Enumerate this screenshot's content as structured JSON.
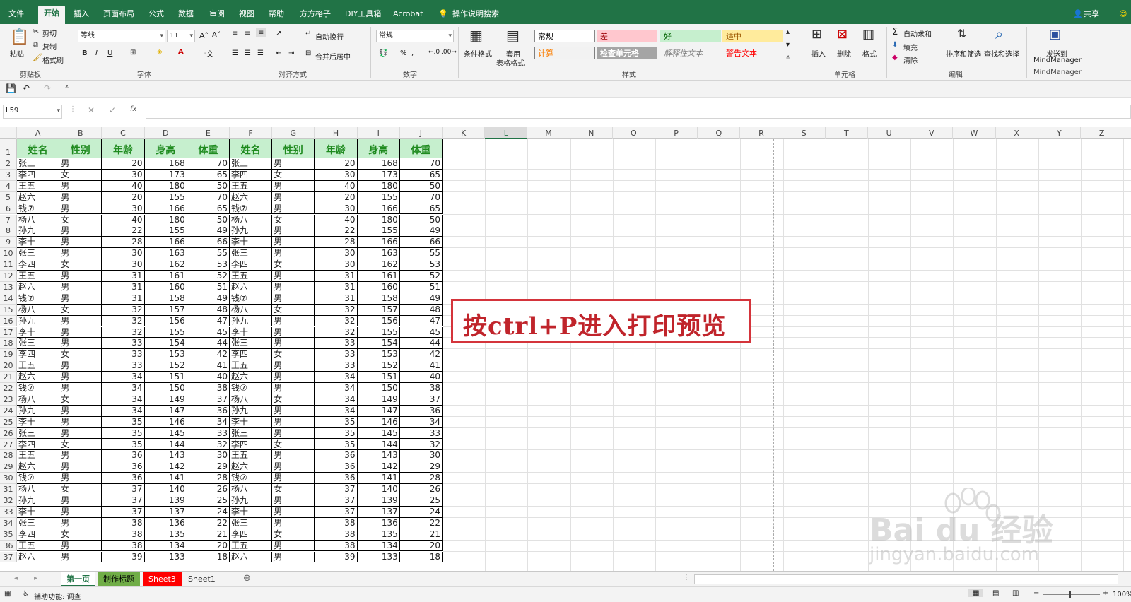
{
  "menu": {
    "tabs": [
      "文件",
      "开始",
      "插入",
      "页面布局",
      "公式",
      "数据",
      "审阅",
      "视图",
      "帮助",
      "方方格子",
      "DIY工具箱",
      "Acrobat"
    ],
    "active": "开始",
    "tell_me": "操作说明搜索",
    "share": "共享"
  },
  "ribbon": {
    "clipboard": {
      "paste": "粘贴",
      "cut": "剪切",
      "copy": "复制",
      "format_painter": "格式刷",
      "label": "剪贴板"
    },
    "font": {
      "name": "等线",
      "size": "11",
      "bold": "B",
      "italic": "I",
      "underline": "U",
      "label": "字体"
    },
    "align": {
      "wrap": "自动换行",
      "merge": "合并后居中",
      "label": "对齐方式"
    },
    "number": {
      "format": "常规",
      "label": "数字"
    },
    "styles": {
      "cond": "条件格式",
      "table1": "套用",
      "table2": "表格格式",
      "label": "样式",
      "cells": [
        {
          "t": "常规",
          "bg": "#ffffff",
          "fg": "#000000"
        },
        {
          "t": "差",
          "bg": "#ffc7ce",
          "fg": "#9c0006"
        },
        {
          "t": "好",
          "bg": "#c6efce",
          "fg": "#006100"
        },
        {
          "t": "适中",
          "bg": "#ffeb9c",
          "fg": "#9c5700"
        },
        {
          "t": "计算",
          "bg": "#f2f2f2",
          "fg": "#fa7d00"
        },
        {
          "t": "检查单元格",
          "bg": "#a5a5a5",
          "fg": "#ffffff"
        },
        {
          "t": "解释性文本",
          "bg": "#f3f3f3",
          "fg": "#7f7f7f"
        },
        {
          "t": "警告文本",
          "bg": "#f3f3f3",
          "fg": "#ff0000"
        }
      ]
    },
    "cells": {
      "insert": "插入",
      "delete": "删除",
      "format": "格式",
      "label": "单元格"
    },
    "editing": {
      "autosum": "自动求和",
      "fill": "填充",
      "clear": "清除",
      "sort": "排序和筛选",
      "find": "查找和选择",
      "label": "编辑"
    },
    "mm": {
      "send": "发送到",
      "mm1": "MindManager",
      "label": "MindManager"
    }
  },
  "formula": {
    "namebox": "L59",
    "fx": "fx"
  },
  "columns": [
    "A",
    "B",
    "C",
    "D",
    "E",
    "F",
    "G",
    "H",
    "I",
    "J",
    "K",
    "L",
    "M",
    "N",
    "O",
    "P",
    "Q",
    "R",
    "S",
    "T",
    "U",
    "V",
    "W",
    "X",
    "Y",
    "Z"
  ],
  "headers": [
    "姓名",
    "性别",
    "年龄",
    "身高",
    "体重",
    "姓名",
    "性别",
    "年龄",
    "身高",
    "体重"
  ],
  "rows": [
    [
      "张三",
      "男",
      20,
      168,
      70
    ],
    [
      "李四",
      "女",
      30,
      173,
      65
    ],
    [
      "王五",
      "男",
      40,
      180,
      50
    ],
    [
      "赵六",
      "男",
      20,
      155,
      70
    ],
    [
      "钱⑦",
      "男",
      30,
      166,
      65
    ],
    [
      "杨八",
      "女",
      40,
      180,
      50
    ],
    [
      "孙九",
      "男",
      22,
      155,
      49
    ],
    [
      "李十",
      "男",
      28,
      166,
      66
    ],
    [
      "张三",
      "男",
      30,
      163,
      55
    ],
    [
      "李四",
      "女",
      30,
      162,
      53
    ],
    [
      "王五",
      "男",
      31,
      161,
      52
    ],
    [
      "赵六",
      "男",
      31,
      160,
      51
    ],
    [
      "钱⑦",
      "男",
      31,
      158,
      49
    ],
    [
      "杨八",
      "女",
      32,
      157,
      48
    ],
    [
      "孙九",
      "男",
      32,
      156,
      47
    ],
    [
      "李十",
      "男",
      32,
      155,
      45
    ],
    [
      "张三",
      "男",
      33,
      154,
      44
    ],
    [
      "李四",
      "女",
      33,
      153,
      42
    ],
    [
      "王五",
      "男",
      33,
      152,
      41
    ],
    [
      "赵六",
      "男",
      34,
      151,
      40
    ],
    [
      "钱⑦",
      "男",
      34,
      150,
      38
    ],
    [
      "杨八",
      "女",
      34,
      149,
      37
    ],
    [
      "孙九",
      "男",
      34,
      147,
      36
    ],
    [
      "李十",
      "男",
      35,
      146,
      34
    ],
    [
      "张三",
      "男",
      35,
      145,
      33
    ],
    [
      "李四",
      "女",
      35,
      144,
      32
    ],
    [
      "王五",
      "男",
      36,
      143,
      30
    ],
    [
      "赵六",
      "男",
      36,
      142,
      29
    ],
    [
      "钱⑦",
      "男",
      36,
      141,
      28
    ],
    [
      "杨八",
      "女",
      37,
      140,
      26
    ],
    [
      "孙九",
      "男",
      37,
      139,
      25
    ],
    [
      "李十",
      "男",
      37,
      137,
      24
    ],
    [
      "张三",
      "男",
      38,
      136,
      22
    ],
    [
      "李四",
      "女",
      38,
      135,
      21
    ],
    [
      "王五",
      "男",
      38,
      134,
      20
    ],
    [
      "赵六",
      "男",
      39,
      133,
      18
    ]
  ],
  "callout": "按ctrl+P进入打印预览",
  "sheets": [
    {
      "name": "第一页",
      "bg": "#ffffff",
      "fg": "#217346"
    },
    {
      "name": "制作标题",
      "bg": "#70ad47",
      "fg": "#000000"
    },
    {
      "name": "Sheet3",
      "bg": "#ff0000",
      "fg": "#ffffff"
    },
    {
      "name": "Sheet1",
      "bg": "#f3f3f3",
      "fg": "#333333"
    }
  ],
  "status": {
    "accessibility": "辅助功能: 调查",
    "zoom": "100%"
  },
  "watermark": {
    "brand": "Bai du 经验",
    "url": "jingyan.baidu.com"
  }
}
